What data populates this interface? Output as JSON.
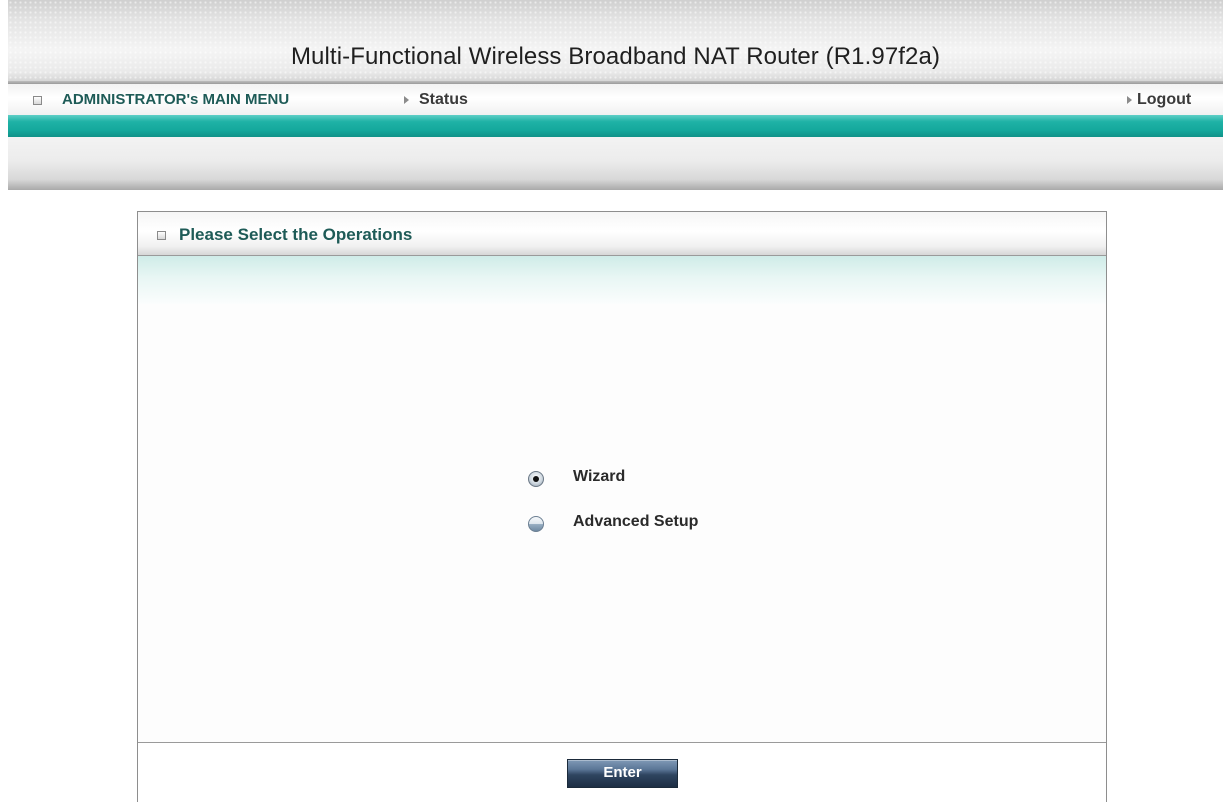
{
  "header": {
    "title": "Multi-Functional Wireless Broadband NAT Router (R1.97f2a)"
  },
  "nav": {
    "admin_menu": "ADMINISTRATOR's MAIN MENU",
    "status": "Status",
    "logout": "Logout"
  },
  "panel": {
    "title": "Please Select the Operations",
    "options": [
      {
        "label": "Wizard",
        "selected": true
      },
      {
        "label": "Advanced Setup",
        "selected": false
      }
    ],
    "enter_button": "Enter"
  },
  "colors": {
    "teal_accent": "#14a89c",
    "heading_text": "#1e5b57",
    "button_dark": "#1d2e44"
  }
}
